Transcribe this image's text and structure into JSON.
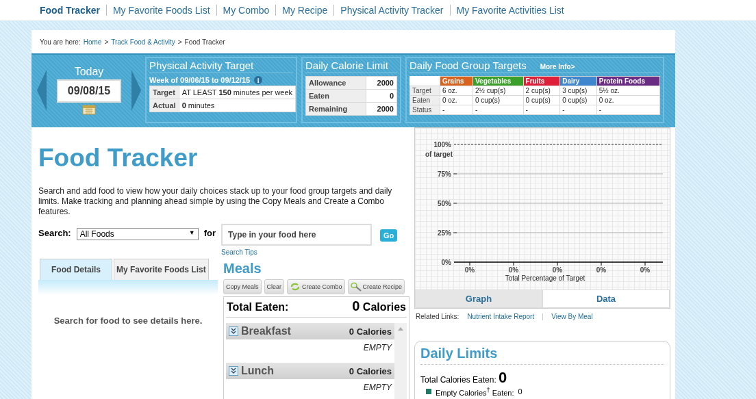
{
  "nav": {
    "items": [
      {
        "label": "Food Tracker",
        "selected": true
      },
      {
        "label": "My Favorite Foods List",
        "selected": false
      },
      {
        "label": "My Combo",
        "selected": false
      },
      {
        "label": "My Recipe",
        "selected": false
      },
      {
        "label": "Physical Activity Tracker",
        "selected": false
      },
      {
        "label": "My Favorite Activities List",
        "selected": false
      }
    ]
  },
  "breadcrumb": [
    {
      "kind": "text",
      "text": "You are here:"
    },
    {
      "kind": "link",
      "text": "Home"
    },
    {
      "kind": "text",
      "text": ">"
    },
    {
      "kind": "link",
      "text": "Track Food & Activity"
    },
    {
      "kind": "text",
      "text": ">"
    },
    {
      "kind": "text",
      "text": "Food Tracker"
    }
  ],
  "date": {
    "label": "Today",
    "value": "09/08/15"
  },
  "activity": {
    "title": "Physical Activity Target",
    "week": "Week of 09/06/15 to 09/12/15",
    "info": "i",
    "rows": [
      {
        "label": "Target",
        "value": "AT LEAST **150** minutes per week"
      },
      {
        "label": "Actual",
        "value": "**0**  minutes"
      }
    ]
  },
  "calorie_limit": {
    "title": "Daily Calorie Limit",
    "rows": [
      {
        "label": "Allowance",
        "value": "2000"
      },
      {
        "label": "Eaten",
        "value": "0"
      },
      {
        "label": "Remaining",
        "value": "2000"
      }
    ]
  },
  "food_groups": {
    "title": "Daily Food Group Targets",
    "more_info": "More Info>",
    "columns": [
      {
        "name": "Grains",
        "color": "#d9621c"
      },
      {
        "name": "Vegetables",
        "color": "#3aa02a"
      },
      {
        "name": "Fruits",
        "color": "#e0203a"
      },
      {
        "name": "Dairy",
        "color": "#3f86cf"
      },
      {
        "name": "Protein Foods",
        "color": "#6b2c86"
      }
    ],
    "rows": [
      {
        "label": "Target",
        "cells": [
          "6 oz.",
          "2½ cup(s)",
          "2 cup(s)",
          "3 cup(s)",
          "5½ oz."
        ]
      },
      {
        "label": "Eaten",
        "cells": [
          "0 oz.",
          "0 cup(s)",
          "0 cup(s)",
          "0 cup(s)",
          "0 oz."
        ]
      },
      {
        "label": "Status",
        "cells": [
          "-",
          "-",
          "-",
          "-",
          "-"
        ]
      }
    ]
  },
  "page": {
    "title": "Food Tracker",
    "description": "Search and add food to view how your daily choices stack up to your food group targets and daily limits. Make tracking and planning ahead simple by using the Copy Meals and Create a Combo features."
  },
  "search": {
    "label": "Search:",
    "select": "All Foods",
    "select_arrow": "▼",
    "for": "for",
    "placeholder": "Type in your food here",
    "go": "Go",
    "tips": "Search Tips"
  },
  "left_tabs": [
    {
      "label": "Food Details",
      "selected": true
    },
    {
      "label": "My Favorite Foods List",
      "selected": false
    }
  ],
  "details_message": "Search for food to see details here.",
  "meals": {
    "title": "Meals",
    "buttons": [
      {
        "label": "Copy Meals",
        "kind": "plain"
      },
      {
        "label": "Clear",
        "kind": "plain"
      },
      {
        "label": "Create Combo",
        "kind": "combo"
      },
      {
        "label": "Create Recipe",
        "kind": "recipe"
      }
    ],
    "total_label": "Total Eaten:",
    "total_value": "0",
    "total_unit": "Calories",
    "list": [
      {
        "name": "Breakfast",
        "calories": "0 Calories",
        "status": "EMPTY"
      },
      {
        "name": "Lunch",
        "calories": "0 Calories",
        "status": "EMPTY"
      }
    ]
  },
  "chart_data": {
    "type": "bar",
    "grid": true,
    "ylabel": "of target",
    "xlabel": "Total Percentage of Target",
    "values": [
      0,
      0,
      0,
      0,
      0
    ],
    "ylim": [
      0,
      100
    ],
    "yticks": [
      {
        "value": 0,
        "label": "0%"
      },
      {
        "value": 25,
        "label": "25%"
      },
      {
        "value": 50,
        "label": "50%"
      },
      {
        "value": 75,
        "label": "75%"
      },
      {
        "value": 100,
        "label": "100%"
      }
    ],
    "data_labels": true,
    "value_labels": [
      "0%",
      "0%",
      "0%",
      "0%",
      "0%"
    ]
  },
  "view_tabs": [
    {
      "label": "Graph",
      "selected": true
    },
    {
      "label": "Data",
      "selected": false
    }
  ],
  "related": {
    "label": "Related Links:",
    "links": [
      "Nutrient Intake Report",
      "View By Meal"
    ]
  },
  "daily_limits": {
    "title": "Daily Limits",
    "total_label": "Total Calories Eaten:",
    "total_value": "0",
    "items": [
      {
        "label": "Empty Calories$^{†}$ Eaten:",
        "value": "0",
        "color": "#1e7a64"
      }
    ]
  }
}
